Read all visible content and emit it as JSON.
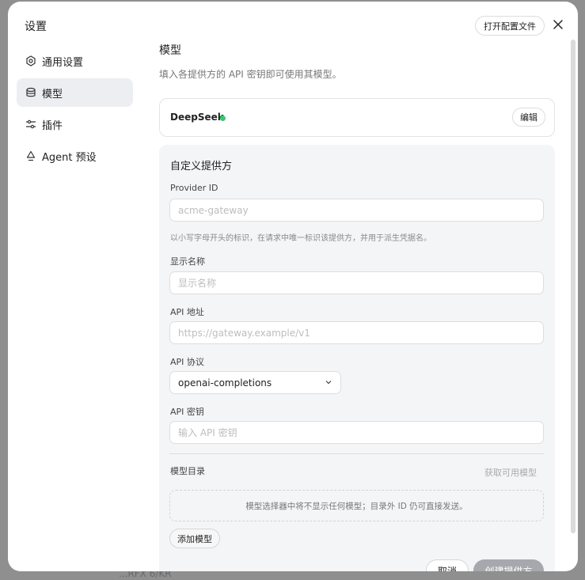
{
  "background": {
    "hint": "...RFX 6/KR"
  },
  "dialog": {
    "title": "设置",
    "open_config_label": "打开配置文件",
    "close_icon": "close-icon"
  },
  "sidebar": {
    "items": [
      {
        "label": "通用设置",
        "icon": "settings-icon",
        "active": false
      },
      {
        "label": "模型",
        "icon": "database-icon",
        "active": true
      },
      {
        "label": "插件",
        "icon": "sliders-icon",
        "active": false
      },
      {
        "label": "Agent 预设",
        "icon": "recycle-icon",
        "active": false
      }
    ]
  },
  "main": {
    "title": "模型",
    "description": "填入各提供方的 API 密钥即可使用其模型。",
    "provider_card": {
      "name": "DeepSeek",
      "status_color": "#2ecc71",
      "edit_label": "编辑"
    },
    "custom_provider": {
      "section_title": "自定义提供方",
      "provider_id": {
        "label": "Provider ID",
        "placeholder": "acme-gateway",
        "hint": "以小写字母开头的标识，在请求中唯一标识该提供方，并用于派生凭据名。"
      },
      "display_name": {
        "label": "显示名称",
        "placeholder": "显示名称"
      },
      "api_url": {
        "label": "API 地址",
        "placeholder": "https://gateway.example/v1"
      },
      "api_protocol": {
        "label": "API 协议",
        "value": "openai-completions"
      },
      "api_key": {
        "label": "API 密钥",
        "placeholder": "输入 API 密钥"
      },
      "model_catalog": {
        "label": "模型目录",
        "fetch_label": "获取可用模型",
        "empty_text": "模型选择器中将不显示任何模型；目录外 ID 仍可直接发送。",
        "add_label": "添加模型"
      },
      "cancel_label": "取消",
      "create_label": "创建提供方"
    }
  }
}
